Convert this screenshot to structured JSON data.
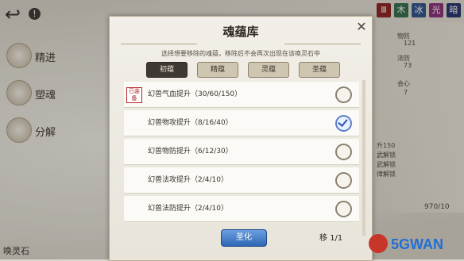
{
  "dialog": {
    "title": "魂蕴库",
    "close_icon": "close-icon",
    "subtitle": "选择想要移除的魂蕴，移除后不会再次出现在该唤灵石中",
    "tabs": [
      {
        "label": "初蕴",
        "active": true
      },
      {
        "label": "精蕴",
        "active": false
      },
      {
        "label": "灵蕴",
        "active": false
      },
      {
        "label": "圣蕴",
        "active": false
      }
    ],
    "items": [
      {
        "label": "幻兽气血提升（30/60/150）",
        "checked": false,
        "badge": "已装备"
      },
      {
        "label": "幻兽物攻提升（8/16/40）",
        "checked": true
      },
      {
        "label": "幻兽物防提升（6/12/30）",
        "checked": false
      },
      {
        "label": "幻兽法攻提升（2/4/10）",
        "checked": false
      },
      {
        "label": "幻兽法防提升（2/4/10）",
        "checked": false
      }
    ],
    "confirm_label": "圣化",
    "page_prefix": "移",
    "page_count": "1/1"
  },
  "left_menu": {
    "items": [
      {
        "label": "精进"
      },
      {
        "label": "塑魂"
      },
      {
        "label": "分解"
      }
    ],
    "bottom_label": "唤灵石"
  },
  "right_panel": {
    "stats": [
      {
        "label": "物防",
        "value": "121"
      },
      {
        "label": "法防",
        "value": "73"
      },
      {
        "label": "会心",
        "value": "7"
      }
    ],
    "counter": "970/10",
    "notes": [
      "升150",
      "武解锁",
      "武解锁",
      "律解锁"
    ]
  },
  "watermark": {
    "text": "5GWAN"
  },
  "colors": {
    "confirm": "#2f66b4",
    "checked": "#2d57b5",
    "badge": "#b3262a"
  }
}
